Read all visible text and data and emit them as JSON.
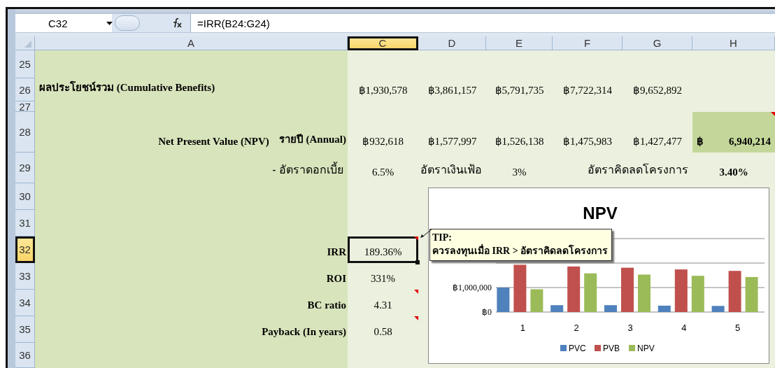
{
  "formula_bar": {
    "name_box": "C32",
    "formula": "=IRR(B24:G24)"
  },
  "columns": [
    {
      "label": "A",
      "selected": false
    },
    {
      "label": "C",
      "selected": true
    },
    {
      "label": "D",
      "selected": false
    },
    {
      "label": "E",
      "selected": false
    },
    {
      "label": "F",
      "selected": false
    },
    {
      "label": "G",
      "selected": false
    },
    {
      "label": "H",
      "selected": false
    }
  ],
  "rows": [
    {
      "number": "25",
      "selected": false,
      "cells": {}
    },
    {
      "number": "26",
      "selected": false,
      "cells": {
        "a": {
          "kind": "heading",
          "text": "ผลประโยชน์รวม (Cumulative Benefits)",
          "selected": false
        },
        "c": {
          "kind": "value",
          "text": "฿1,930,578",
          "selected": false
        },
        "d": {
          "kind": "value",
          "text": "฿3,861,157",
          "selected": false
        },
        "e": {
          "kind": "value",
          "text": "฿5,791,735",
          "selected": false
        },
        "f": {
          "kind": "value",
          "text": "฿7,722,314",
          "selected": false
        },
        "g": {
          "kind": "value",
          "text": "฿9,652,892",
          "selected": false
        }
      }
    },
    {
      "number": "27",
      "selected": false,
      "cells": {}
    },
    {
      "number": "28",
      "selected": false,
      "cells": {
        "a": {
          "kind": "label",
          "texts": [
            "Net Present Value (NPV)",
            "รายปี (Annual)"
          ],
          "selected": false
        },
        "c": {
          "kind": "value",
          "text": "฿932,618",
          "selected": false
        },
        "d": {
          "kind": "value",
          "text": "฿1,577,997",
          "selected": false
        },
        "e": {
          "kind": "value",
          "text": "฿1,526,138",
          "selected": false
        },
        "f": {
          "kind": "value",
          "text": "฿1,475,983",
          "selected": false
        },
        "g": {
          "kind": "value",
          "text": "฿1,427,477",
          "selected": false
        },
        "h": {
          "kind": "total",
          "texts": [
            "฿",
            "6,940,214"
          ],
          "selected": false,
          "comment": true
        }
      }
    },
    {
      "number": "29",
      "selected": false,
      "cells": {
        "a": {
          "kind": "plain",
          "text": "-  อัตราดอกเบี้ย",
          "selected": false
        },
        "c": {
          "kind": "value",
          "text": "6.5%",
          "selected": false
        },
        "d": {
          "kind": "plain",
          "text": "อัตราเงินเฟ้อ",
          "selected": false
        },
        "e": {
          "kind": "value",
          "text": "3%",
          "selected": false
        },
        "g": {
          "kind": "plain",
          "text": "อัตราคิดลดโครงการ",
          "selected": false
        },
        "h": {
          "kind": "strong",
          "text": "3.40%",
          "selected": false
        }
      }
    },
    {
      "number": "30",
      "selected": false,
      "cells": {}
    },
    {
      "number": "31",
      "selected": false,
      "cells": {}
    },
    {
      "number": "32",
      "selected": true,
      "cells": {
        "a": {
          "kind": "label",
          "text": "IRR",
          "selected": false
        },
        "c": {
          "kind": "value",
          "text": "189.36%",
          "selected": true,
          "comment": true
        }
      }
    },
    {
      "number": "33",
      "selected": false,
      "cells": {
        "a": {
          "kind": "label",
          "text": "ROI",
          "selected": false
        },
        "c": {
          "kind": "value",
          "text": "331%",
          "selected": false
        }
      }
    },
    {
      "number": "34",
      "selected": false,
      "cells": {
        "a": {
          "kind": "label",
          "text": "BC ratio",
          "selected": false
        },
        "c": {
          "kind": "value",
          "text": "4.31",
          "selected": false,
          "comment": true
        }
      }
    },
    {
      "number": "35",
      "selected": false,
      "cells": {
        "a": {
          "kind": "label",
          "text": "Payback (In years)",
          "selected": false
        },
        "c": {
          "kind": "value",
          "text": "0.58",
          "selected": false,
          "comment": true
        }
      }
    },
    {
      "number": "36",
      "selected": false,
      "cells": {}
    }
  ],
  "comment_popup": {
    "title": "TIP:",
    "text": "ควรลงทุนเมื่อ IRR > อัตราคิดลดโครงการ"
  },
  "chart": {
    "chart_data": {
      "type": "bar",
      "title": "NPV",
      "categories": [
        "1",
        "2",
        "3",
        "4",
        "5"
      ],
      "series": [
        {
          "name": "PVC",
          "color": "#4f81bd",
          "values": [
            1000000,
            280000,
            280000,
            260000,
            250000
          ]
        },
        {
          "name": "PVB",
          "color": "#c0504d",
          "values": [
            1930000,
            1860000,
            1810000,
            1740000,
            1680000
          ]
        },
        {
          "name": "NPV",
          "color": "#9bbb59",
          "values": [
            930000,
            1580000,
            1530000,
            1480000,
            1430000
          ]
        }
      ],
      "legend": true,
      "ylim": [
        0,
        3000000
      ],
      "yticks": [
        {
          "value": 0,
          "label": "฿0"
        },
        {
          "value": 1000000,
          "label": "฿1,000,000"
        }
      ]
    }
  }
}
